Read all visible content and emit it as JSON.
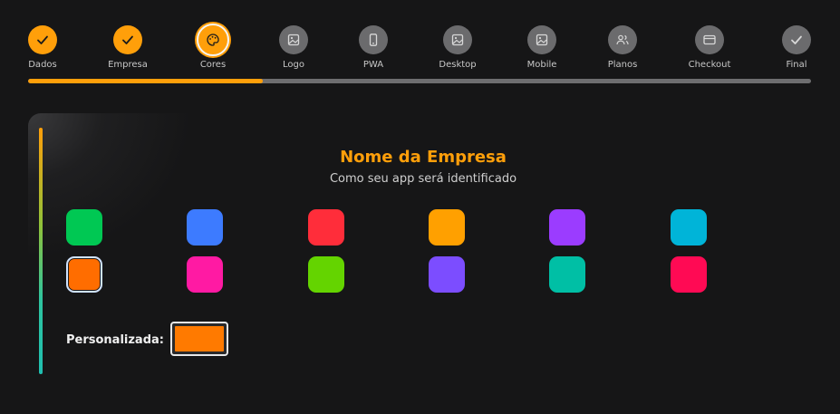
{
  "stepper": {
    "steps": [
      {
        "label": "Dados",
        "state": "done",
        "icon": "check-icon"
      },
      {
        "label": "Empresa",
        "state": "done",
        "icon": "check-icon"
      },
      {
        "label": "Cores",
        "state": "current",
        "icon": "palette-icon"
      },
      {
        "label": "Logo",
        "state": "pending",
        "icon": "image-icon"
      },
      {
        "label": "PWA",
        "state": "pending",
        "icon": "smartphone-icon"
      },
      {
        "label": "Desktop",
        "state": "pending",
        "icon": "image-icon"
      },
      {
        "label": "Mobile",
        "state": "pending",
        "icon": "image-icon"
      },
      {
        "label": "Planos",
        "state": "pending",
        "icon": "users-icon"
      },
      {
        "label": "Checkout",
        "state": "pending",
        "icon": "credit-card-icon"
      },
      {
        "label": "Final",
        "state": "pending",
        "icon": "check-icon"
      }
    ],
    "progress_percent": 30
  },
  "colors": {
    "accent": "#ff9f0a",
    "pending": "#6b6b6d",
    "background": "#161617"
  },
  "card": {
    "title": "Nome da Empresa",
    "subtitle": "Como seu app será identificado",
    "palette": [
      {
        "color": "#00c853",
        "selected": false
      },
      {
        "color": "#3d7bff",
        "selected": false
      },
      {
        "color": "#ff2d3a",
        "selected": false
      },
      {
        "color": "#ffa000",
        "selected": false
      },
      {
        "color": "#9b3cff",
        "selected": false
      },
      {
        "color": "#00b4d8",
        "selected": false
      },
      {
        "color": "#ff6d00",
        "selected": true
      },
      {
        "color": "#ff1aa3",
        "selected": false
      },
      {
        "color": "#64d400",
        "selected": false
      },
      {
        "color": "#7c4dff",
        "selected": false
      },
      {
        "color": "#00bfa5",
        "selected": false
      },
      {
        "color": "#ff0a54",
        "selected": false
      }
    ],
    "custom_label": "Personalizada:",
    "custom_color": "#ff7a00"
  }
}
